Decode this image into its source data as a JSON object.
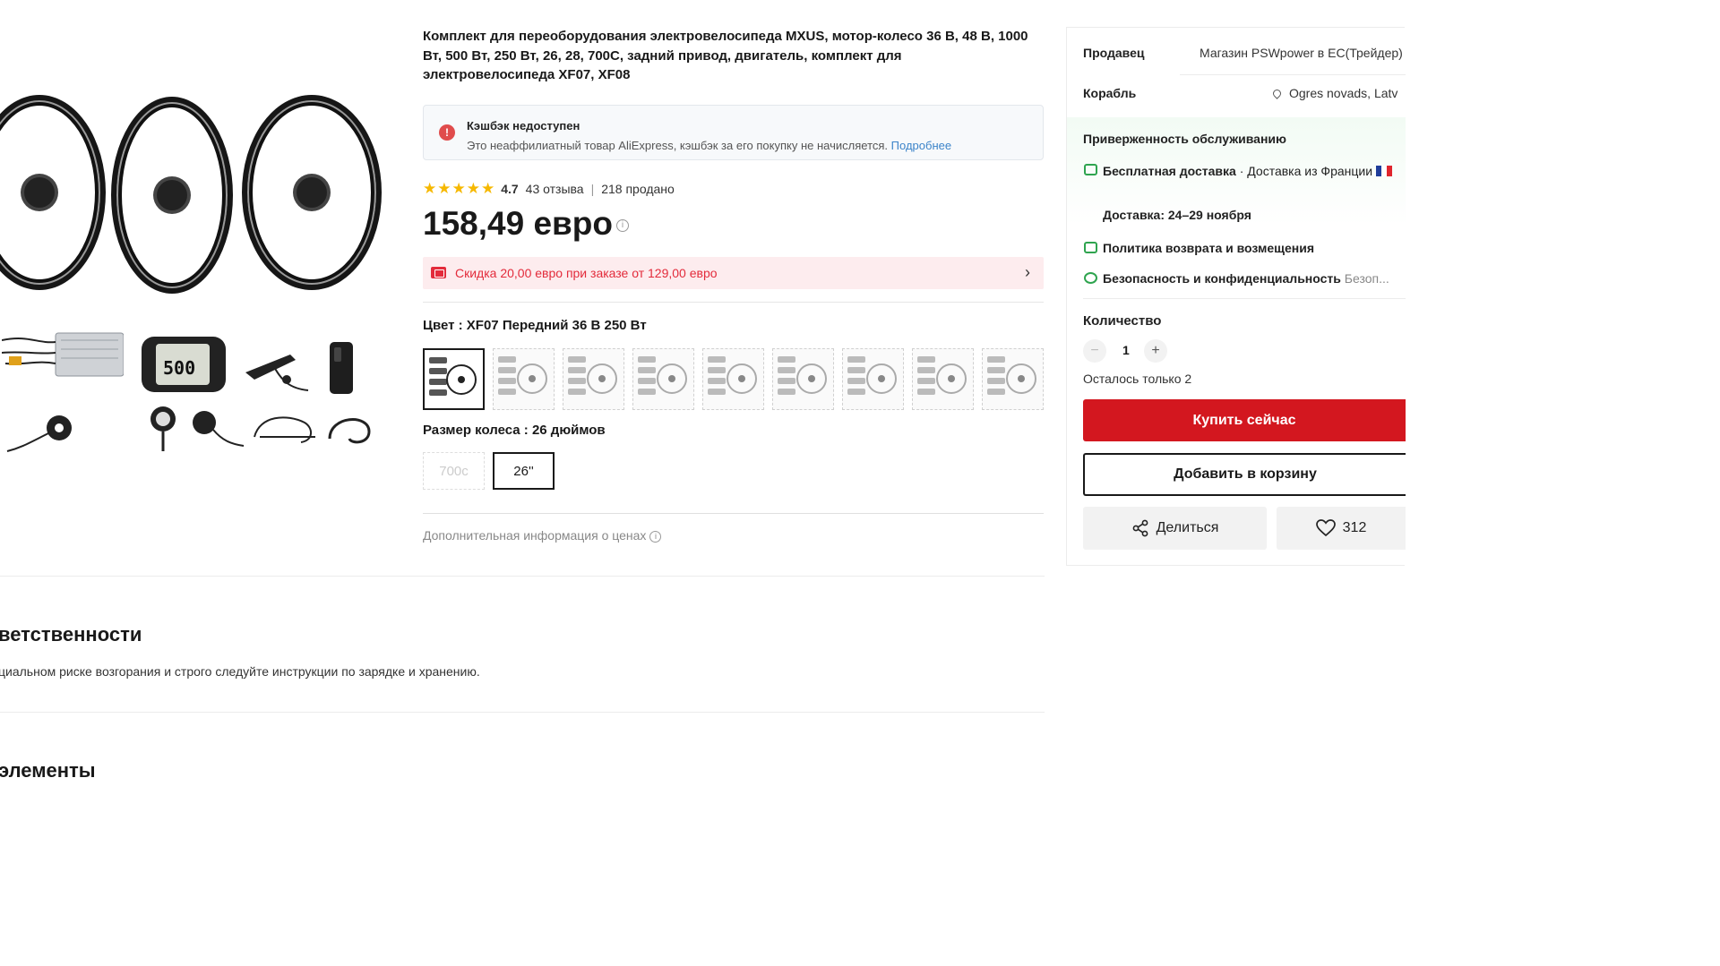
{
  "product": {
    "title": "Комплект для переоборудования электровелосипеда MXUS, мотор-колесо 36 В, 48 В, 1000 Вт, 500 Вт, 250 Вт, 26, 28, 700C, задний привод, двигатель, комплект для электровелосипеда XF07, XF08",
    "cashback": {
      "heading": "Кэшбэк недоступен",
      "text": "Это неаффилиатный товар AliExpress, кэшбэк за его покупку не начисляется.",
      "link": "Подробнее"
    },
    "rating": {
      "stars": "★★★★★",
      "score": "4.7",
      "reviews": "43 отзыва",
      "sold": "218 продано"
    },
    "price": "158,49 евро",
    "discount": "Скидка 20,00 евро при заказе от 129,00 евро",
    "color": {
      "label": "Цвет : XF07 Передний 36 В 250 Вт",
      "options_count": 9,
      "selected_index": 0
    },
    "wheel_size": {
      "label": "Размер колеса : 26 дюймов",
      "options": [
        "700c",
        "26''"
      ],
      "selected": "26''"
    },
    "extra_info": "Дополнительная информация о ценах"
  },
  "seller_panel": {
    "seller_label": "Продавец",
    "seller_value": "Магазин PSWpower в ЕС(Трейдер)",
    "ship_label": "Корабль",
    "ship_value": "Ogres novads, Latv",
    "guarantee_title": "Приверженность обслуживанию",
    "free_shipping": "Бесплатная доставка",
    "ship_from": "Доставка из Франции",
    "delivery": "Доставка: 24–29 ноября",
    "returns": "Политика возврата и возмещения",
    "security": "Безопасность и конфиденциальность",
    "security_more": "Безоп...",
    "quantity_label": "Количество",
    "quantity": "1",
    "stock": "Осталось только 2",
    "buy_now": "Купить сейчас",
    "add_to_cart": "Добавить в корзину",
    "share": "Делиться",
    "wishlist_count": "312"
  },
  "sections": {
    "responsibility_title": "ветственности",
    "responsibility_text": "циальном риске возгорания и строго следуйте инструкции по зарядке и хранению.",
    "elements_title": "элементы"
  },
  "colors": {
    "accent_red": "#d3171f",
    "discount_red": "#e32b3b",
    "link_blue": "#3c84c9",
    "star_yellow": "#f6b800",
    "guarantee_green": "#2fa44f"
  }
}
